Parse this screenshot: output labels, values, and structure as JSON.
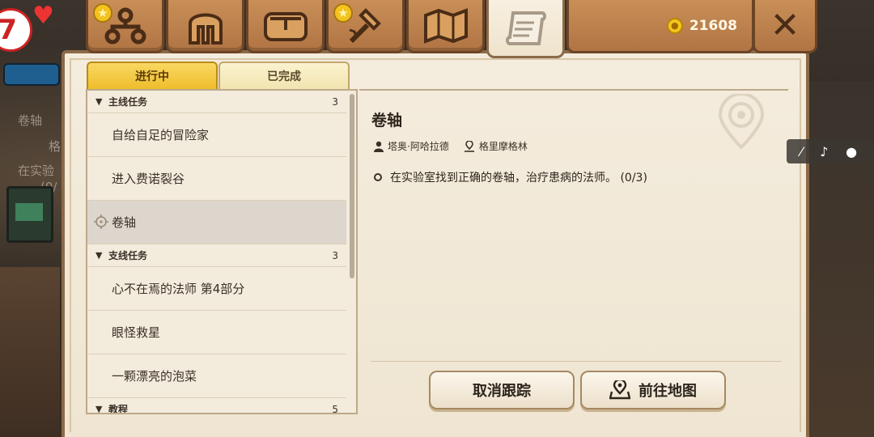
{
  "header": {
    "tabs": [
      {
        "icon": "hierarchy-icon",
        "star": true
      },
      {
        "icon": "helmet-icon",
        "star": false
      },
      {
        "icon": "bag-icon",
        "star": false
      },
      {
        "icon": "hammer-icon",
        "star": true
      },
      {
        "icon": "map-icon",
        "star": false
      },
      {
        "icon": "scroll-icon",
        "star": false,
        "active": true
      }
    ],
    "gold": "21608",
    "close_symbol": "✕"
  },
  "status_tabs": {
    "in_progress": "进行中",
    "completed": "已完成"
  },
  "quest_list": {
    "categories": [
      {
        "label": "主线任务",
        "count": "3",
        "items": [
          "自给自足的冒险家",
          "进入费诺裂谷",
          "卷轴"
        ]
      },
      {
        "label": "支线任务",
        "count": "3",
        "items": [
          "心不在焉的法师 第4部分",
          "眼怪救星",
          "一颗漂亮的泡菜"
        ]
      },
      {
        "label": "教程",
        "count": "5",
        "items": []
      }
    ],
    "selected": "卷轴"
  },
  "detail": {
    "title": "卷轴",
    "npc": "塔奥·阿哈拉德",
    "location": "格里摩格林",
    "objective": "在实验室找到正确的卷轴，治疗患病的法师。 (0/3)",
    "cancel_tracking": "取消跟踪",
    "go_to_map": "前往地图"
  },
  "background": {
    "level": "7",
    "ghost_title": "卷轴",
    "ghost_line1": "格",
    "ghost_line2": "在实验",
    "ghost_line3": "(0/"
  },
  "colors": {
    "parchment": "#f4ecdd",
    "wood": "#c98f57",
    "accent_yellow": "#efbd2c"
  }
}
